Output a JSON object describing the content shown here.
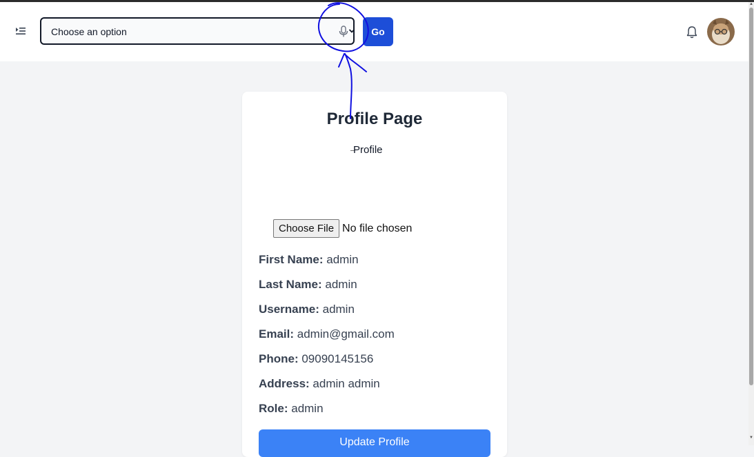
{
  "header": {
    "select": {
      "value": "Choose an option"
    },
    "go_label": "Go"
  },
  "card": {
    "title": "Profile Page",
    "image_alt": "Profile",
    "file_input": {
      "button_label": "Choose File",
      "status": "No file chosen"
    },
    "fields": [
      {
        "label": "First Name:",
        "value": "admin"
      },
      {
        "label": "Last Name:",
        "value": "admin"
      },
      {
        "label": "Username:",
        "value": "admin"
      },
      {
        "label": "Email:",
        "value": "admin@gmail.com"
      },
      {
        "label": "Phone:",
        "value": "09090145156"
      },
      {
        "label": "Address:",
        "value": "admin admin"
      },
      {
        "label": "Role:",
        "value": "admin"
      }
    ],
    "update_label": "Update Profile"
  },
  "icons": {
    "menu": "menu-expand-icon",
    "mic": "microphone-icon",
    "chevron": "chevron-down-icon",
    "bell": "bell-icon",
    "avatar": "user-avatar"
  },
  "colors": {
    "accent": "#1d4ed8",
    "update_button": "#3b82f6",
    "background": "#f3f4f6",
    "annotation": "#1010e0"
  }
}
